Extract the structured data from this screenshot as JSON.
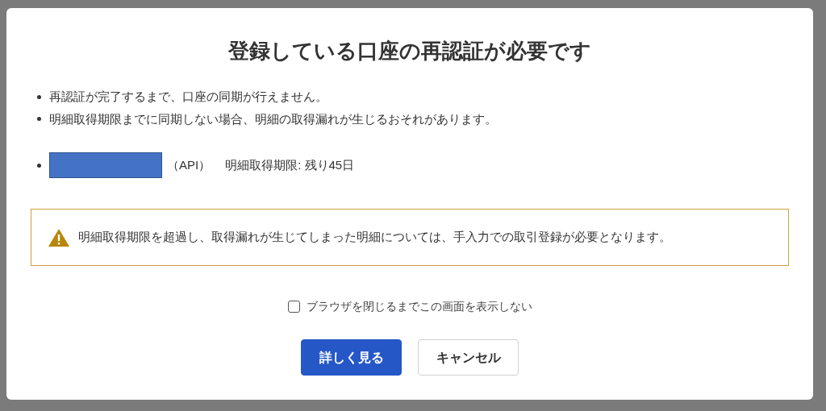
{
  "dialog": {
    "title": "登録している口座の再認証が必要です",
    "notes": [
      "再認証が完了するまで、口座の同期が行えません。",
      "明細取得期限までに同期しない場合、明細の取得漏れが生じるおそれがあります。"
    ],
    "accounts": [
      {
        "type": "（API）",
        "deadline": "明細取得期限: 残り45日"
      }
    ],
    "warning": "明細取得期限を超過し、取得漏れが生じてしまった明細については、手入力での取引登録が必要となります。",
    "dont_show": {
      "label": "ブラウザを閉じるまでこの画面を表示しない",
      "checked": false
    },
    "buttons": [
      {
        "label": "詳しく見る",
        "kind": "primary"
      },
      {
        "label": "キャンセル",
        "kind": "secondary"
      }
    ]
  }
}
